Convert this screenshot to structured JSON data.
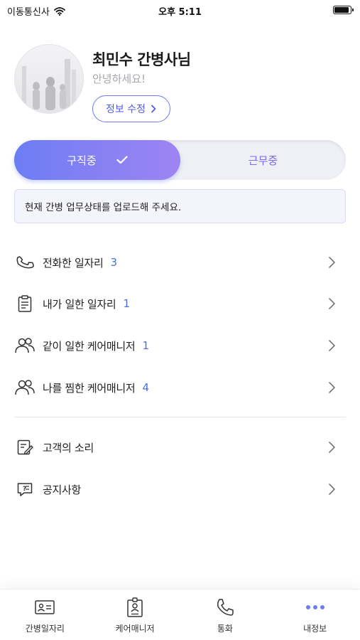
{
  "status_bar": {
    "carrier": "이동통신사",
    "time": "오후 5:11"
  },
  "profile": {
    "name": "최민수 간병사님",
    "greeting": "안녕하세요!",
    "edit_label": "정보 수정"
  },
  "status_toggle": {
    "seeking_label": "구직중",
    "working_label": "근무중",
    "selected": "구직중"
  },
  "notice": "현재 간병 업무상태를 업로드해 주세요.",
  "menu": {
    "items": [
      {
        "label": "전화한 일자리",
        "count": "3",
        "icon": "phone-outline-icon"
      },
      {
        "label": "내가 일한 일자리",
        "count": "1",
        "icon": "clipboard-icon"
      },
      {
        "label": "같이 일한 케어매니저",
        "count": "1",
        "icon": "people-icon"
      },
      {
        "label": "나를 찜한 케어매니저",
        "count": "4",
        "icon": "people-icon"
      }
    ],
    "extra": [
      {
        "label": "고객의 소리",
        "icon": "edit-note-icon"
      },
      {
        "label": "공지사항",
        "icon": "question-chat-icon"
      }
    ]
  },
  "tabbar": {
    "tabs": [
      {
        "label": "간병일자리",
        "icon": "id-card-icon"
      },
      {
        "label": "케어매니저",
        "icon": "badge-icon"
      },
      {
        "label": "통화",
        "icon": "phone-icon"
      },
      {
        "label": "내정보",
        "icon": "more-dots-icon"
      }
    ],
    "active": "내정보"
  },
  "colors": {
    "accent": "#6c7df3",
    "accent_gradient_end": "#9e84f3",
    "count": "#4c6fd6",
    "notice_bg": "#f4f4fd"
  }
}
